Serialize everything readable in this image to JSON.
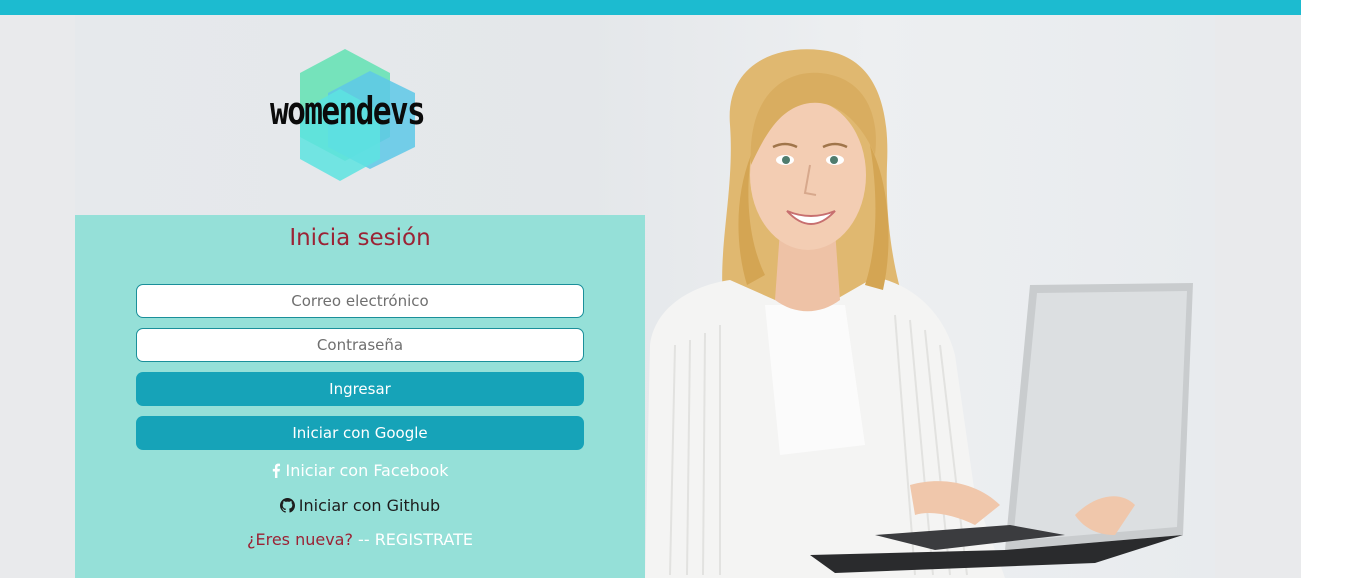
{
  "brand": {
    "logo_text": "womendevs",
    "colors": {
      "topbar": "#1cbbd0",
      "panel": "#95e0d8",
      "button": "#16a3b8",
      "title": "#9b2335"
    }
  },
  "login": {
    "title": "Inicia sesión",
    "email_placeholder": "Correo electrónico",
    "password_placeholder": "Contraseña",
    "submit_label": "Ingresar",
    "google_label": "Iniciar con Google",
    "facebook_label": "Iniciar con Facebook",
    "github_label": "Iniciar con Github",
    "register_question": "¿Eres nueva?",
    "register_separator": " -- ",
    "register_link": "REGISTRATE"
  },
  "icons": {
    "facebook": "facebook-icon",
    "github": "github-icon"
  }
}
